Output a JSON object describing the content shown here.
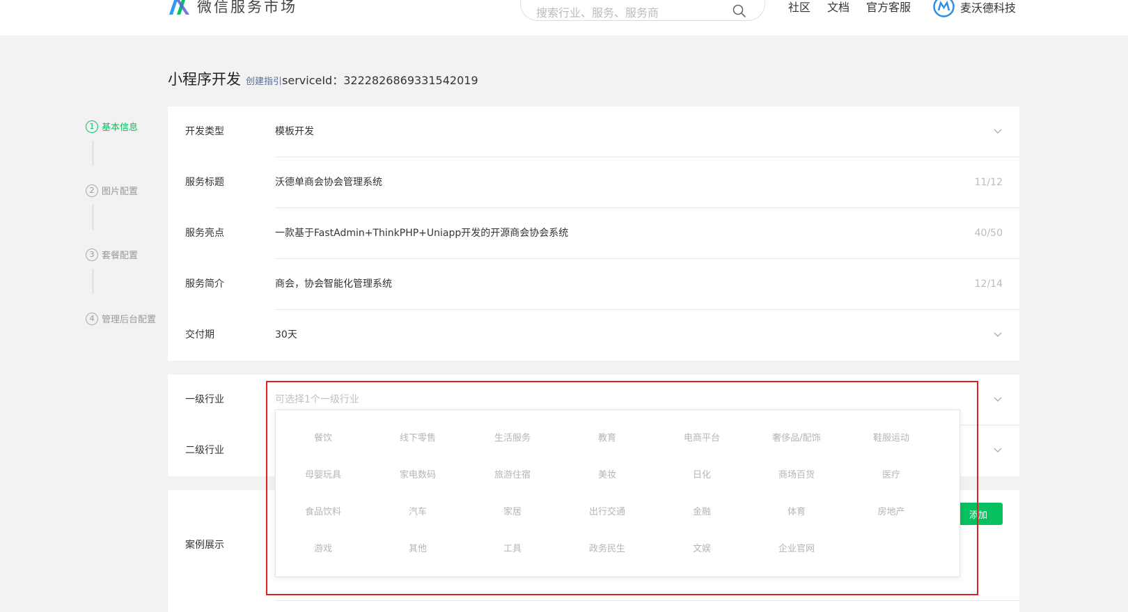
{
  "header": {
    "logo_text": "微信服务市场",
    "search_placeholder": "搜索行业、服务、服务商",
    "nav": [
      "社区",
      "文档",
      "官方客服"
    ],
    "user_name": "麦沃德科技"
  },
  "title": {
    "page_title": "小程序开发",
    "guide_link": "创建指引",
    "service_id": "serviceId：3222826869331542019"
  },
  "steps": [
    {
      "num": "1",
      "label": "基本信息"
    },
    {
      "num": "2",
      "label": "图片配置"
    },
    {
      "num": "3",
      "label": "套餐配置"
    },
    {
      "num": "4",
      "label": "管理后台配置"
    }
  ],
  "basic": {
    "dev_type": {
      "label": "开发类型",
      "value": "模板开发"
    },
    "service_title": {
      "label": "服务标题",
      "value": "沃德单商会协会管理系统",
      "counter": "11/12"
    },
    "highlight": {
      "label": "服务亮点",
      "value": "一款基于FastAdmin+ThinkPHP+Uniapp开发的开源商会协会系统",
      "counter": "40/50"
    },
    "intro": {
      "label": "服务简介",
      "value": "商会，协会智能化管理系统",
      "counter": "12/14"
    },
    "delivery": {
      "label": "交付期",
      "value": "30天"
    }
  },
  "industry": {
    "level1_label": "一级行业",
    "level1_placeholder": "可选择1个一级行业",
    "level2_label": "二级行业",
    "options": [
      "餐饮",
      "线下零售",
      "生活服务",
      "教育",
      "电商平台",
      "奢侈品/配饰",
      "鞋服运动",
      "母婴玩具",
      "家电数码",
      "旅游住宿",
      "美妆",
      "日化",
      "商场百货",
      "医疗",
      "食品饮料",
      "汽车",
      "家居",
      "出行交通",
      "金融",
      "体育",
      "房地产",
      "游戏",
      "其他",
      "工具",
      "政务民生",
      "文娱",
      "企业官网"
    ]
  },
  "cases": {
    "label": "案例展示",
    "add_button": "添加"
  },
  "colors": {
    "accent": "#07c160",
    "highlight": "#e02020",
    "link": "#576b95"
  }
}
